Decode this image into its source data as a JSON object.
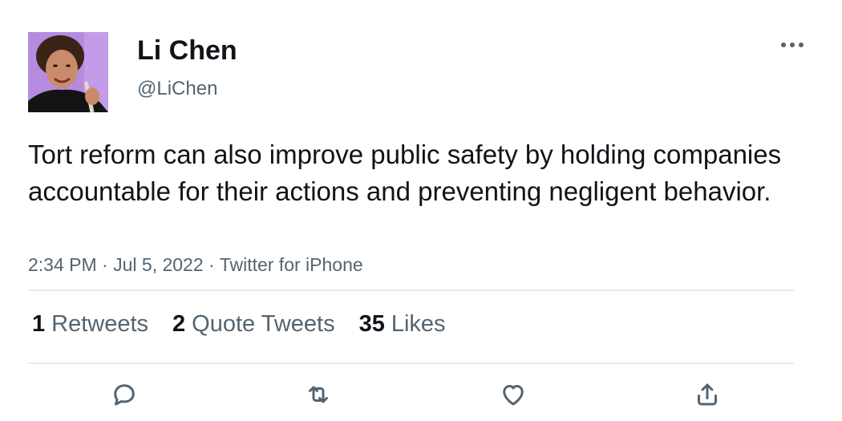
{
  "author": {
    "name": "Li Chen",
    "handle": "@LiChen"
  },
  "tweet": {
    "text": "Tort reform can also improve public safety by holding companies accountable for their actions and preventing negligent behavior.",
    "time": "2:34 PM",
    "date": "Jul 5, 2022",
    "source": "Twitter for iPhone",
    "sep": "·"
  },
  "stats": {
    "retweets": {
      "count": "1",
      "label": "Retweets"
    },
    "quote_tweets": {
      "count": "2",
      "label": "Quote Tweets"
    },
    "likes": {
      "count": "35",
      "label": "Likes"
    }
  },
  "icons": {
    "more": "more-horizontal-icon",
    "reply": "reply-icon",
    "retweet": "retweet-icon",
    "like": "heart-icon",
    "share": "share-icon"
  },
  "colors": {
    "text": "#0f1419",
    "secondary": "#536471",
    "divider": "#e7e9eb",
    "avatar_bg": "#b58be0"
  }
}
